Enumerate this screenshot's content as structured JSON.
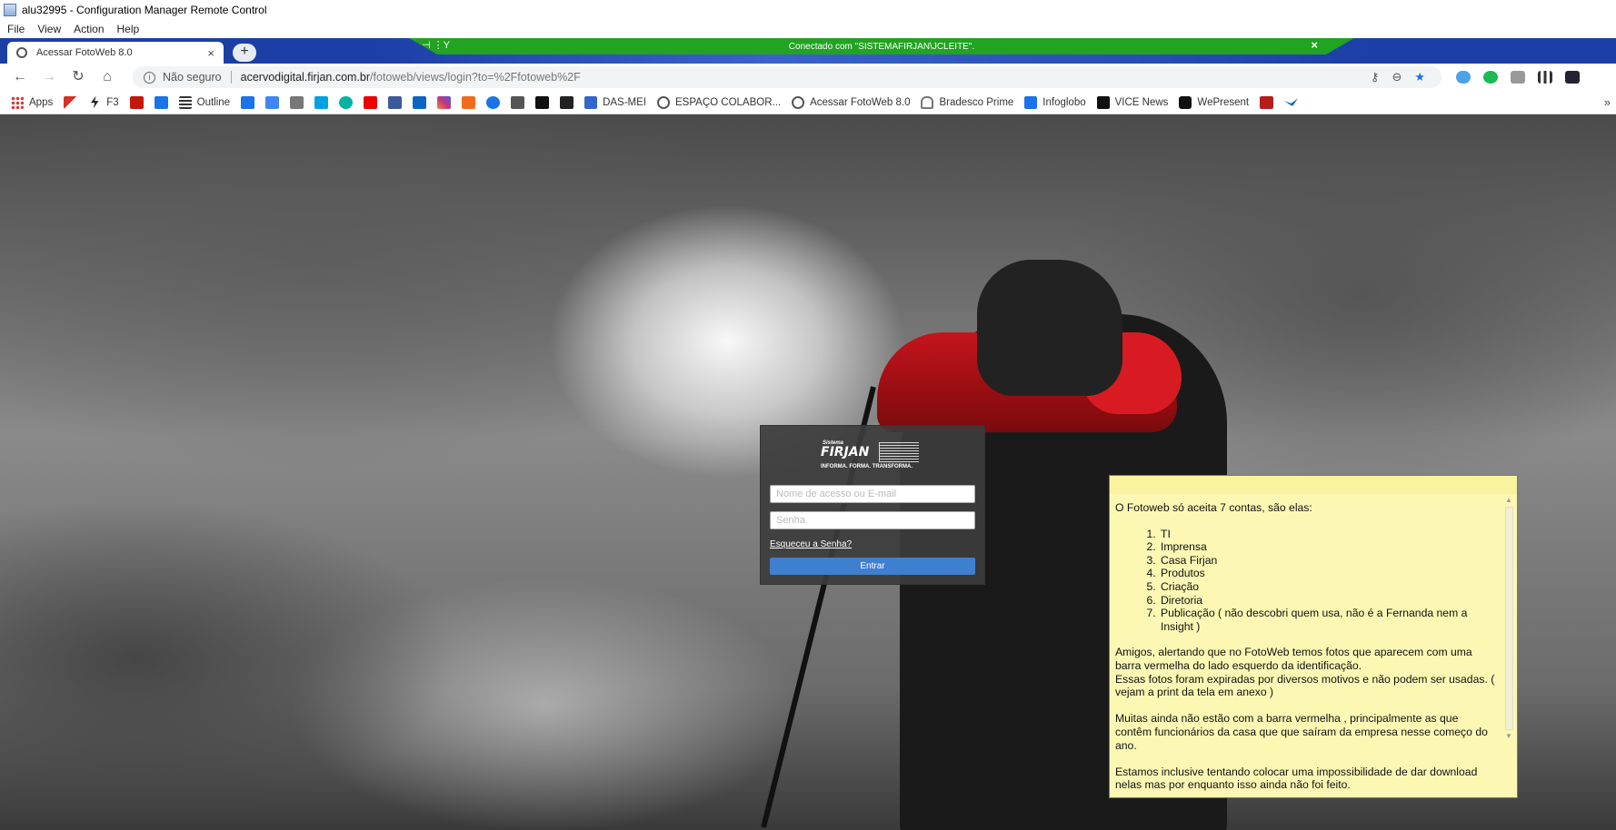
{
  "window": {
    "title": "alu32995 - Configuration Manager Remote Control",
    "menu": [
      "File",
      "View",
      "Action",
      "Help"
    ]
  },
  "browser": {
    "tab_title": "Acessar FotoWeb 8.0",
    "tab_close": "×",
    "new_tab": "+",
    "connection_text": "Conectado com \"SISTEMAFIRJAN\\JCLEITE\".",
    "connection_close": "×",
    "security_label": "Não seguro",
    "url_host": "acervodigital.firjan.com.br",
    "url_path": "/fotoweb/views/login?to=%2Ffotoweb%2F"
  },
  "bookmarks": [
    {
      "label": "Apps",
      "icon": "apps-grid-icon",
      "color": "#d33"
    },
    {
      "label": "",
      "icon": "gmail-icon",
      "color": "#d93025"
    },
    {
      "label": "F3",
      "icon": "bolt-icon",
      "color": "#222"
    },
    {
      "label": "",
      "icon": "g1-icon",
      "color": "#c4170c"
    },
    {
      "label": "",
      "icon": "google-icon",
      "color": "#1a73e8"
    },
    {
      "label": "Outline",
      "icon": "outline-icon",
      "color": "#333"
    },
    {
      "label": "",
      "icon": "f-icon",
      "color": "#1a73e8"
    },
    {
      "label": "",
      "icon": "translate-icon",
      "color": "#4285f4"
    },
    {
      "label": "",
      "icon": "dg-icon",
      "color": "#444"
    },
    {
      "label": "",
      "icon": "s-icon",
      "color": "#00a3e0"
    },
    {
      "label": "",
      "icon": "check-circle-icon",
      "color": "#00b3a4"
    },
    {
      "label": "",
      "icon": "santander-icon",
      "color": "#ec0000"
    },
    {
      "label": "",
      "icon": "facebook-icon",
      "color": "#3b5998"
    },
    {
      "label": "",
      "icon": "linkedin-icon",
      "color": "#0a66c2"
    },
    {
      "label": "",
      "icon": "instagram-icon",
      "color": "#c13584"
    },
    {
      "label": "",
      "icon": "k-icon",
      "color": "#f26b1d"
    },
    {
      "label": "",
      "icon": "gear-icon",
      "color": "#1a73e8"
    },
    {
      "label": "",
      "icon": "tt-icon",
      "color": "#333"
    },
    {
      "label": "",
      "icon": "a-icon",
      "color": "#111"
    },
    {
      "label": "",
      "icon": "cv-icon",
      "color": "#222"
    },
    {
      "label": "DAS-MEI",
      "icon": "das-mei-icon",
      "color": "#3366cc"
    },
    {
      "label": "ESPAÇO COLABOR...",
      "icon": "globe-icon",
      "color": "#555"
    },
    {
      "label": "Acessar FotoWeb 8.0",
      "icon": "globe-icon",
      "color": "#555"
    },
    {
      "label": "Bradesco Prime",
      "icon": "bradesco-icon",
      "color": "#555"
    },
    {
      "label": "Infoglobo",
      "icon": "infoglobo-icon",
      "color": "#1a73e8"
    },
    {
      "label": "VICE News",
      "icon": "vn-icon",
      "color": "#111"
    },
    {
      "label": "WePresent",
      "icon": "we-icon",
      "color": "#111"
    },
    {
      "label": "",
      "icon": "adi-icon",
      "color": "#b71c1c"
    },
    {
      "label": "",
      "icon": "bird-icon",
      "color": "#1565c0"
    }
  ],
  "bookmarks_more": "»",
  "login": {
    "logo_small": "Sistema",
    "logo_brand": "FIRJAN",
    "logo_tagline": "INFORMA. FORMA. TRANSFORMA.",
    "username_placeholder": "Nome de acesso ou E-mail",
    "password_placeholder": "Senha",
    "forgot_link": "Esqueceu a Senha?",
    "submit_label": "Entrar",
    "button_color": "#3f7fd0"
  },
  "note": {
    "intro": "O Fotoweb só aceita 7 contas, são elas:",
    "accounts": [
      "TI",
      "Imprensa",
      "Casa Firjan",
      "Produtos",
      "Criação",
      "Diretoria",
      "Publicação ( não descobri quem usa, não é a Fernanda nem a Insight )"
    ],
    "para1_line1": "Amigos, alertando que no FotoWeb temos fotos que aparecem com uma barra vermelha do lado esquerdo da identificação.",
    "para1_line2": "Essas fotos foram expiradas por diversos motivos e não podem ser usadas. ( vejam a print da tela em anexo )",
    "para2": "Muitas ainda não estão com a barra vermelha , principalmente as que contêm funcionários da casa que que saíram da empresa nesse começo do ano.",
    "para3": "Estamos inclusive tentando colocar uma impossibilidade de dar download nelas mas por enquanto isso ainda não foi feito."
  }
}
